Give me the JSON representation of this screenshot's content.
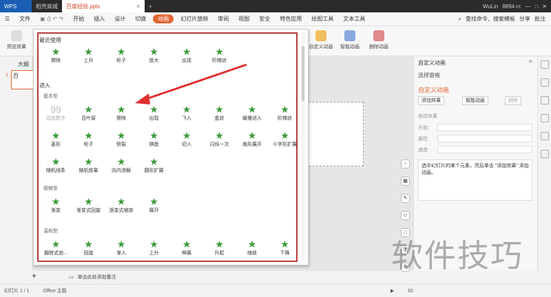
{
  "titlebar": {
    "app": "WPS",
    "tab1": "稻壳商城",
    "tab2": "百度经验.pptx",
    "user": "WuLin",
    "code": "8894-rc"
  },
  "menu": {
    "file": "文件",
    "items": [
      "开始",
      "插入",
      "设计",
      "切换",
      "动画",
      "幻灯片放映",
      "审阅",
      "视图",
      "安全",
      "特色应用",
      "绘图工具",
      "文本工具"
    ],
    "active": "动画",
    "search": "查找命令、搜索模板",
    "share": "分享",
    "comment": "批注"
  },
  "ribbon": {
    "preview": "预览效果",
    "custom": "自定义动画",
    "smart": "智能动画",
    "delete": "删除动画"
  },
  "left": {
    "tab": "大纲",
    "slide_num": "1",
    "slide_text": "百"
  },
  "dropdown": {
    "recent_title": "最近使用",
    "recent": [
      "擦除",
      "上升",
      "轮子",
      "放大",
      "出现",
      "阶梯状"
    ],
    "enter_title": "进入",
    "basic_title": "基本型",
    "basic": [
      "动态数字",
      "百叶窗",
      "擦除",
      "出现",
      "飞入",
      "盒状",
      "缓慢进入",
      "阶梯状",
      "菱形",
      "轮子",
      "劈裂",
      "棋盘",
      "切入",
      "闪烁一次",
      "扇形展开",
      "十字形扩展",
      "随机线条",
      "随机效果",
      "向内溶解",
      "圆形扩展"
    ],
    "subtle_title": "细微型",
    "subtle": [
      "渐变",
      "渐变式回旋",
      "渐变式缩放",
      "展开"
    ],
    "moderate_title": "温和型",
    "moderate": [
      "翻转式由...",
      "回旋",
      "渐入",
      "上升",
      "伸展",
      "升起",
      "缩放",
      "下降"
    ]
  },
  "rightpanel": {
    "title": "自定义动画",
    "select": "选择窗格",
    "heading": "自定义动画",
    "add": "添加效果",
    "smart": "智能动画",
    "delete": "删除",
    "modify": "修改效果",
    "start": "开始:",
    "property": "属性:",
    "speed": "速度:",
    "hint": "选中幻灯片的某个元素，然后单击 \"添加效果\" 添加动画。"
  },
  "status": {
    "slide": "幻灯片 1 / 1",
    "theme": "Office 主题",
    "note": "单击此处添加备注",
    "zoom": "62"
  },
  "watermark": "软件技巧"
}
